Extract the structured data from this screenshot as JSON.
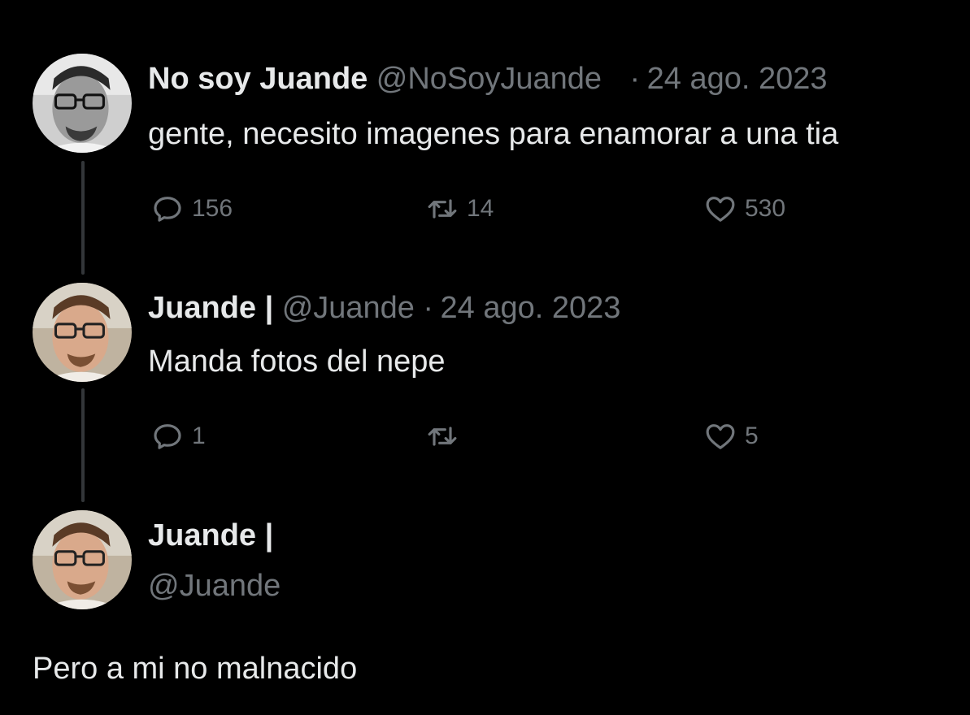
{
  "tweets": [
    {
      "display_name": "No soy Juande",
      "handle": "@NoSoyJuande",
      "separator": "·",
      "date": "24 ago. 2023",
      "text": "gente, necesito imagenes para enamorar a una tia",
      "replies": "156",
      "retweets": "14",
      "likes": "530"
    },
    {
      "display_name": "Juande |",
      "handle": "@Juande",
      "separator": "·",
      "date": "24 ago. 2023",
      "text": "Manda fotos del nepe",
      "replies": "1",
      "retweets": "",
      "likes": "5"
    },
    {
      "display_name": "Juande |",
      "handle": "@Juande",
      "text": "Pero a mi no malnacido"
    }
  ],
  "icons": {
    "reply": "speech-bubble-icon",
    "retweet": "retweet-arrows-icon",
    "like": "heart-outline-icon"
  },
  "colors": {
    "background": "#000000",
    "primary_text": "#e7e9ea",
    "secondary_text": "#71767b",
    "thread_line": "#333639"
  }
}
